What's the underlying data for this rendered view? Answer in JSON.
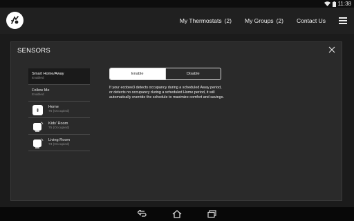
{
  "status_bar": {
    "time": "11:38",
    "icons": [
      "wifi-icon",
      "battery-icon"
    ]
  },
  "header": {
    "logo_icon": "ecobee-logo-icon",
    "nav": [
      {
        "label": "My Thermostats",
        "count": "(2)"
      },
      {
        "label": "My Groups",
        "count": "(2)"
      },
      {
        "label": "Contact Us",
        "count": ""
      }
    ],
    "menu_icon": "hamburger-menu-icon"
  },
  "dialog": {
    "title": "SENSORS",
    "close_icon": "close-icon",
    "items": [
      {
        "name": "Smart Home/Away",
        "status": "Enabled",
        "icon": ""
      },
      {
        "name": "Follow Me",
        "status": "Enabled",
        "icon": ""
      },
      {
        "name": "Home",
        "status": "76 (Occupied)",
        "icon": "thermostat-icon"
      },
      {
        "name": "Kids' Room",
        "status": "75 (Occupied)",
        "icon": "room-sensor-icon"
      },
      {
        "name": "Living Room",
        "status": "73 (Occupied)",
        "icon": "room-sensor-icon"
      }
    ],
    "selected_index": 0,
    "toggle": {
      "enable_label": "Enable",
      "disable_label": "Disable",
      "selected": "Enable"
    },
    "description": "If your ecobee3 detects occupancy during a scheduled Away period, or detects no occupancy during a scheduled Home period, it will automatically override the schedule to maximize comfort and savings."
  },
  "bottom_nav": {
    "icons": [
      "back-icon",
      "home-icon",
      "recent-apps-icon"
    ]
  },
  "colors": {
    "background": "#1b1b1b",
    "header": "#202020",
    "dialog": "#2a2a2a",
    "selected_item": "#1a1a1a",
    "toggle_active": "#ffffff"
  }
}
